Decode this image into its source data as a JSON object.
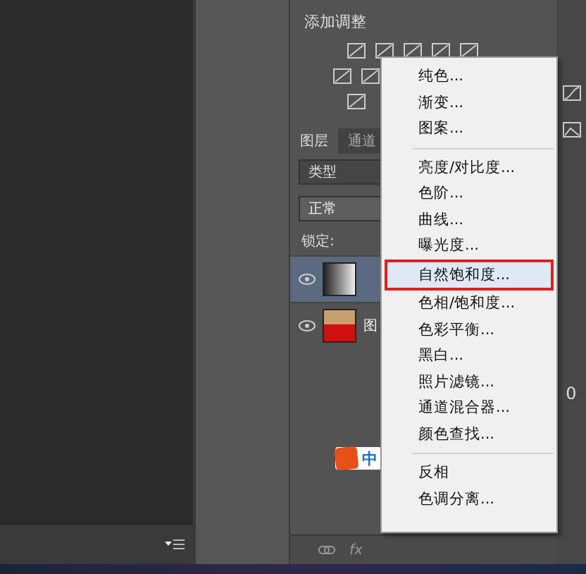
{
  "adjustments_panel": {
    "title": "添加调整"
  },
  "layers_panel": {
    "tabs": [
      {
        "label": "图层",
        "selected": true
      },
      {
        "label": "通道",
        "selected": false
      }
    ],
    "filter": {
      "value": "类型"
    },
    "blend_mode": {
      "value": "正常"
    },
    "lock_label": "锁定:",
    "layers": [
      {
        "kind": "adjustment",
        "visible": true,
        "selected": true
      },
      {
        "kind": "photo",
        "visible": true,
        "selected": false,
        "name": "图"
      }
    ],
    "footer": {
      "fx": "fx"
    }
  },
  "ime_badge": {
    "label": "中"
  },
  "right_dock": {
    "value": "0"
  },
  "menu": {
    "items": [
      {
        "label": "纯色...",
        "selected": false
      },
      {
        "label": "渐变...",
        "selected": false
      },
      {
        "label": "图案...",
        "selected": false
      },
      {
        "kind": "separator"
      },
      {
        "label": "亮度/对比度...",
        "selected": false
      },
      {
        "label": "色阶...",
        "selected": false
      },
      {
        "label": "曲线...",
        "selected": false
      },
      {
        "label": "曝光度...",
        "selected": false
      },
      {
        "label": "自然饱和度...",
        "selected": true
      },
      {
        "label": "色相/饱和度...",
        "selected": false
      },
      {
        "label": "色彩平衡...",
        "selected": false
      },
      {
        "label": "黑白...",
        "selected": false
      },
      {
        "label": "照片滤镜...",
        "selected": false
      },
      {
        "label": "通道混合器...",
        "selected": false
      },
      {
        "label": "颜色查找...",
        "selected": false
      },
      {
        "kind": "separator"
      },
      {
        "label": "反相",
        "selected": false
      },
      {
        "label": "色调分离...",
        "selected": false
      }
    ]
  }
}
